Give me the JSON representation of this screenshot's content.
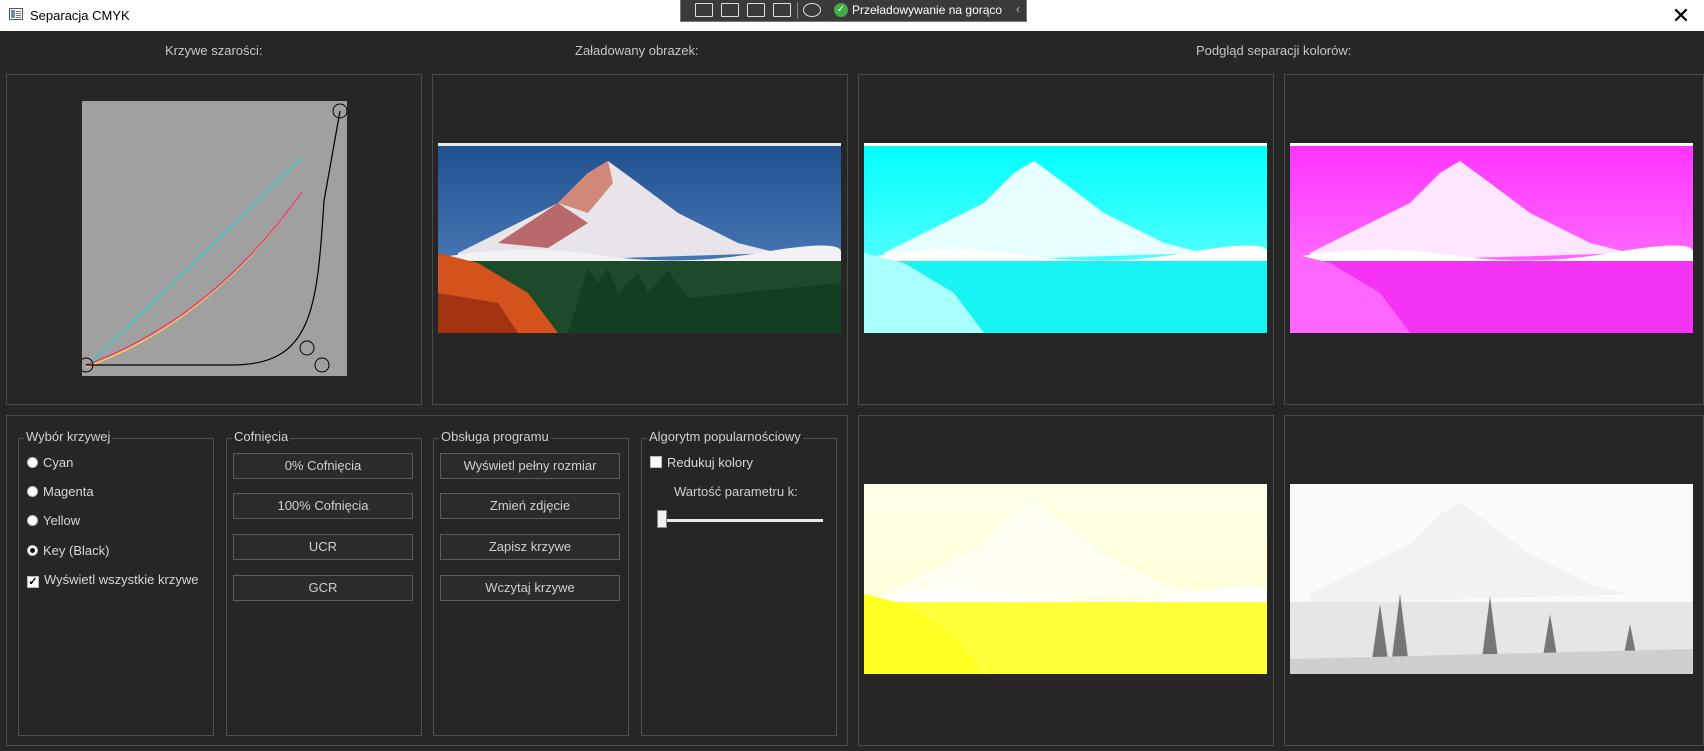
{
  "window": {
    "title": "Separacja CMYK",
    "close_glyph": "✕"
  },
  "devbar": {
    "status_text": "Przeładowywanie na gorąco",
    "status_icon": "checkmark-icon",
    "collapse_glyph": "‹"
  },
  "labels": {
    "curves": "Krzywe szarości:",
    "loaded": "Załadowany obrazek:",
    "preview": "Podgląd separacji kolorów:"
  },
  "curve_select": {
    "title": "Wybór krzywej",
    "options": [
      "Cyan",
      "Magenta",
      "Yellow",
      "Key (Black)"
    ],
    "selected": "Key (Black)",
    "show_all_label": "Wyświetl wszystkie krzywe",
    "show_all_checked": true
  },
  "undercolor": {
    "title": "Cofnięcia",
    "buttons": [
      "0% Cofnięcia",
      "100% Cofnięcia",
      "UCR",
      "GCR"
    ]
  },
  "program": {
    "title": "Obsługa programu",
    "buttons": [
      "Wyświetl pełny rozmiar",
      "Zmień zdjęcie",
      "Zapisz krzywe",
      "Wczytaj krzywe"
    ]
  },
  "popularity": {
    "title": "Algorytm popularnościowy",
    "reduce_label": "Redukuj kolory",
    "reduce_checked": false,
    "param_label": "Wartość parametru k:",
    "param_value": 0
  },
  "colors": {
    "background": "#262626",
    "cyan": "#00ffff",
    "magenta": "#ff00ff",
    "yellow": "#ffff00",
    "curve_bg": "#a0a0a0"
  }
}
